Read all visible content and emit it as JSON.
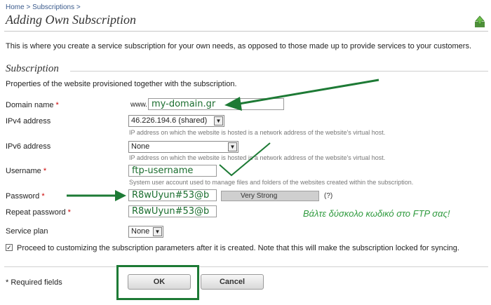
{
  "breadcrumb": {
    "home": "Home",
    "sep": ">",
    "subscriptions": "Subscriptions"
  },
  "page": {
    "title": "Adding Own Subscription",
    "description": "This is where you create a service subscription for your own needs, as opposed to those made up to provide services to your customers."
  },
  "section": {
    "title": "Subscription",
    "description": "Properties of the website provisioned together with the subscription."
  },
  "form": {
    "domain": {
      "label": "Domain name",
      "prefix": "www.",
      "value": "my-domain.gr"
    },
    "ipv4": {
      "label": "IPv4 address",
      "value": "46.226.194.6 (shared)",
      "hint": "IP address on which the website is hosted is a network address of the website's virtual host."
    },
    "ipv6": {
      "label": "IPv6 address",
      "value": "None",
      "hint": "IP address on which the website is hosted is a network address of the website's virtual host."
    },
    "username": {
      "label": "Username",
      "value": "ftp-username",
      "hint": "System user account used to manage files and folders of the websites created within the subscription."
    },
    "password": {
      "label": "Password",
      "value": "R8wUyun#53@b",
      "strength": "Very Strong",
      "help": "(?)"
    },
    "repeat_password": {
      "label": "Repeat password",
      "value": "R8wUyun#53@b"
    },
    "service_plan": {
      "label": "Service plan",
      "value": "None"
    },
    "proceed": {
      "checked": true,
      "label": "Proceed to customizing the subscription parameters after it is created. Note that this will make the subscription locked for syncing."
    },
    "required_marker": "*"
  },
  "annotation": {
    "note": "Βάλτε δύσκολο κωδικό στο FTP σας!",
    "color": "#1d7a35"
  },
  "footer": {
    "required": "* Required fields",
    "ok": "OK",
    "cancel": "Cancel"
  }
}
